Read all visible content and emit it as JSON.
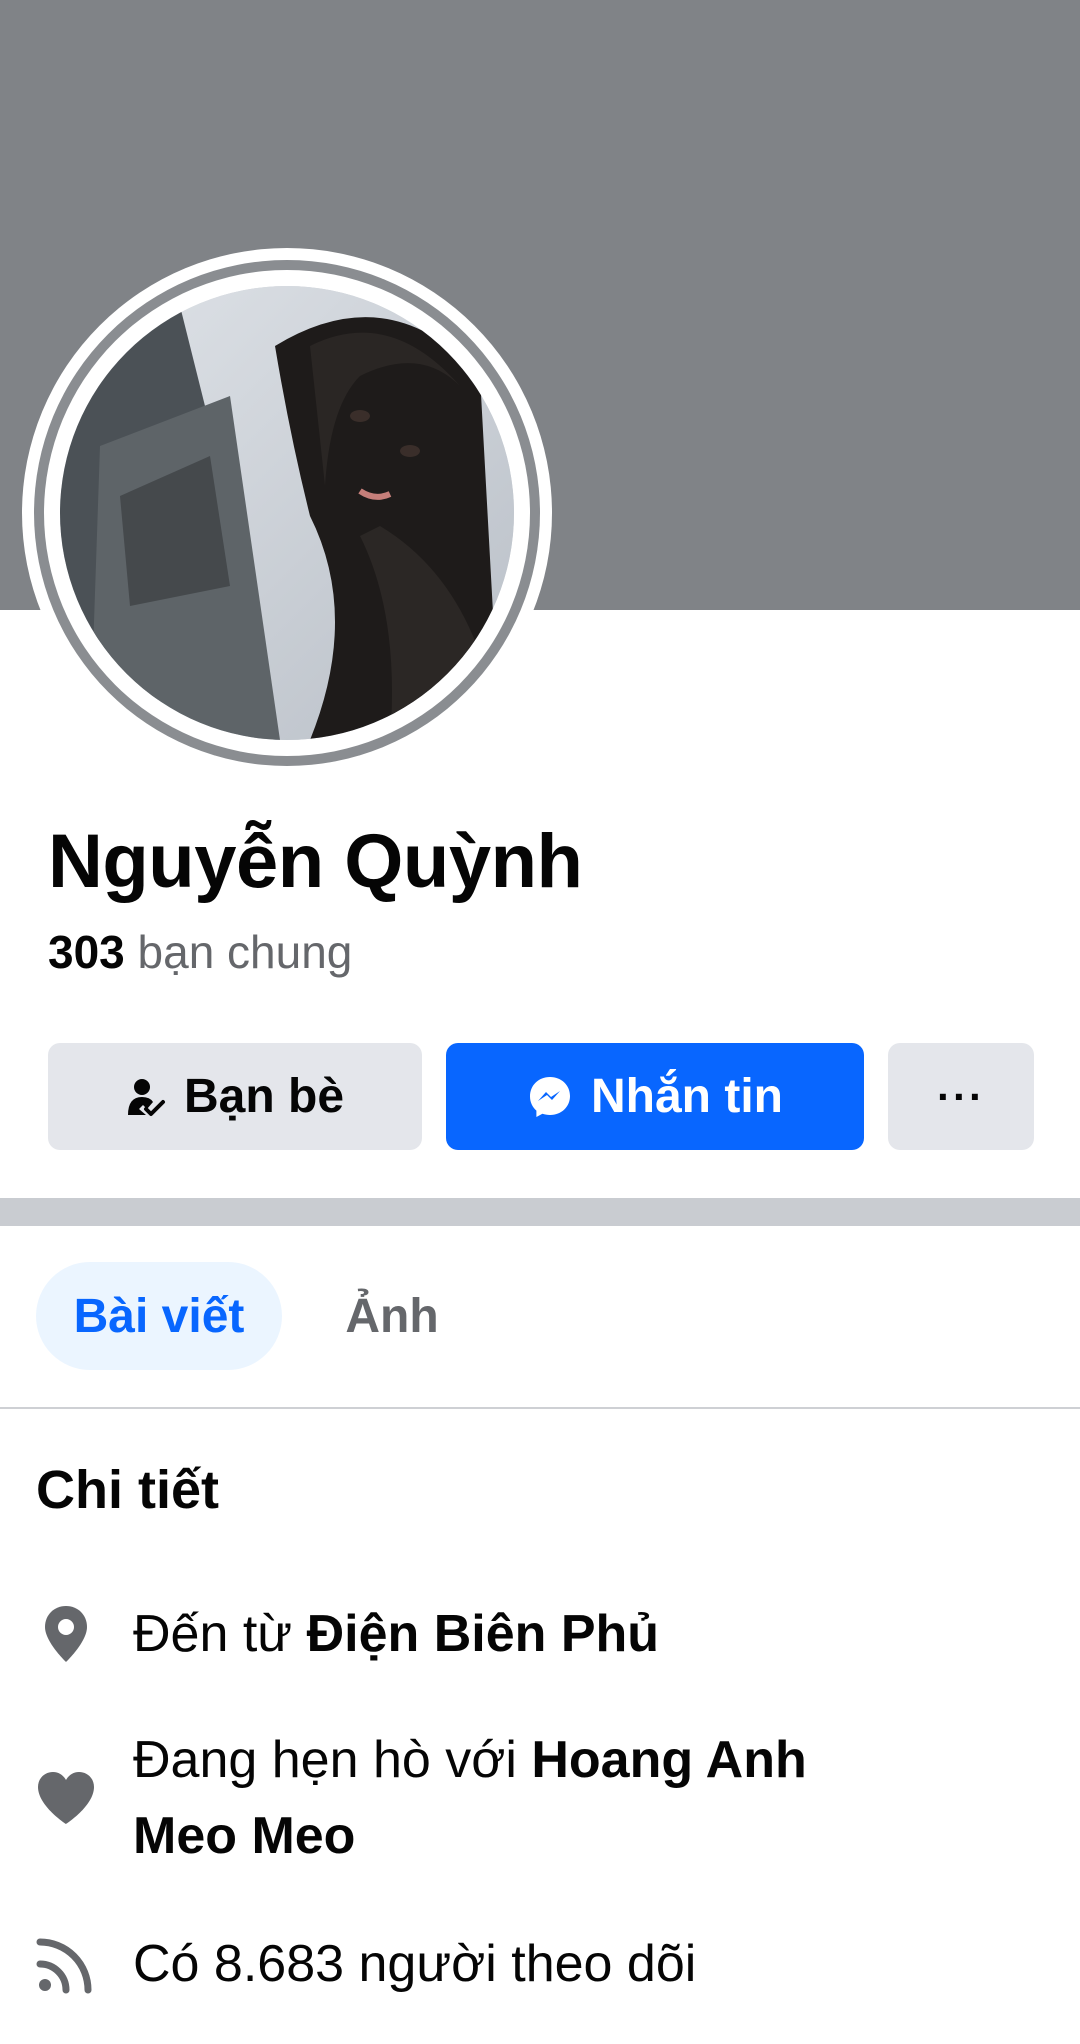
{
  "profile": {
    "name": "Nguyễn Quỳnh",
    "mutual_count": "303",
    "mutual_label": "bạn chung"
  },
  "actions": {
    "friends_label": "Bạn bè",
    "message_label": "Nhắn tin",
    "more_label": "···"
  },
  "tabs": [
    {
      "label": "Bài viết",
      "active": true
    },
    {
      "label": "Ảnh",
      "active": false
    }
  ],
  "details": {
    "title": "Chi tiết",
    "hometown_prefix": "Đến từ",
    "hometown_value": "Điện Biên Phủ",
    "relationship_prefix": "Đang hẹn hò với",
    "relationship_value": "Hoang Anh Meo Meo",
    "followers_text": "Có 8.683 người theo dõi"
  },
  "icons": {
    "friends": "person-check-icon",
    "message": "messenger-icon",
    "hometown": "location-pin-icon",
    "relationship": "heart-icon",
    "followers": "rss-feed-icon"
  },
  "colors": {
    "cover": "#808387",
    "primary": "#0866ff",
    "secondary_button": "#e4e6eb",
    "muted_text": "#65676b"
  }
}
